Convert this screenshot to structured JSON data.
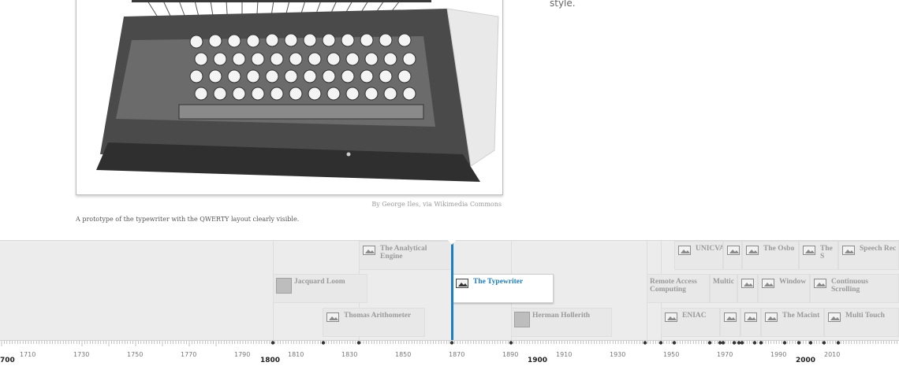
{
  "slide": {
    "text_fragment": "style.",
    "media_credit": "By George Iles, via Wikimedia Commons",
    "media_caption": "A prototype of the typewriter with the QWERTY layout clearly visible.",
    "media_subject": "typewriter-photo"
  },
  "timeline": {
    "markers": [
      {
        "id": "analytical-engine",
        "label": "The Analytical Engine",
        "icon": "image-icon"
      },
      {
        "id": "jacquard-loom",
        "label": "Jacquard Loom",
        "icon": "thumbnail"
      },
      {
        "id": "thomas-arithometer",
        "label": "Thomas Arithometer",
        "icon": "image-icon"
      },
      {
        "id": "typewriter",
        "label": "The Typewriter",
        "icon": "image-icon",
        "active": true
      },
      {
        "id": "herman-hollerith",
        "label": "Herman Hollerith",
        "icon": "thumbnail"
      },
      {
        "id": "unicvac",
        "label": "UNICVA",
        "icon": "image-icon"
      },
      {
        "id": "blank-1",
        "label": "",
        "icon": "image-icon"
      },
      {
        "id": "the-osbo",
        "label": "The Osbo",
        "icon": "image-icon"
      },
      {
        "id": "the-s",
        "label": "The S",
        "icon": "image-icon"
      },
      {
        "id": "speech-rec",
        "label": "Speech Rec",
        "icon": "image-icon"
      },
      {
        "id": "remote-access",
        "label": "Remote Access Computing",
        "icon": "none"
      },
      {
        "id": "multic",
        "label": "Multic",
        "icon": "none"
      },
      {
        "id": "blank-2",
        "label": "",
        "icon": "image-icon"
      },
      {
        "id": "window",
        "label": "Window",
        "icon": "image-icon"
      },
      {
        "id": "continuous-scrolling",
        "label": "Continuous Scrolling",
        "icon": "image-icon"
      },
      {
        "id": "eniac",
        "label": "ENIAC",
        "icon": "image-icon"
      },
      {
        "id": "blank-3",
        "label": "",
        "icon": "image-icon"
      },
      {
        "id": "blank-4",
        "label": "",
        "icon": "image-icon"
      },
      {
        "id": "the-macint",
        "label": "The Macint",
        "icon": "image-icon"
      },
      {
        "id": "multi-touch",
        "label": "Multi Touch",
        "icon": "image-icon"
      }
    ],
    "axis": {
      "minor_labels": [
        "1710",
        "1730",
        "1750",
        "1770",
        "1790",
        "1810",
        "1830",
        "1850",
        "1870",
        "1890",
        "1910",
        "1930",
        "1950",
        "1970",
        "1990",
        "2010"
      ],
      "major_labels": [
        "700",
        "1800",
        "1900",
        "2000"
      ]
    },
    "colors": {
      "active": "#1a7ec1",
      "inactive_text": "#9a9a9a",
      "background": "#ececec"
    }
  }
}
